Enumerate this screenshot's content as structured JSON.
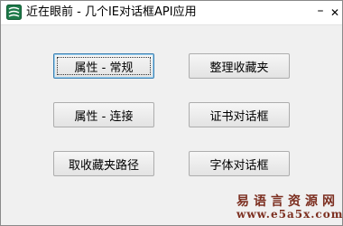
{
  "window": {
    "title": "近在眼前 - 几个IE对话框API应用",
    "app_icon": "app-logo-icon",
    "minimize_label": "–",
    "close_label": "✕"
  },
  "buttons": {
    "props_general": "属性 - 常规",
    "organize_favorites": "整理收藏夹",
    "props_connection": "属性 - 连接",
    "certificate_dialog": "证书对话框",
    "get_favorites_path": "取收藏夹路径",
    "font_dialog": "字体对话框"
  },
  "watermark": {
    "site_name": "易语言资源网",
    "url": "www.e5a5x.com",
    "color": "#7c2f20"
  },
  "colors": {
    "window_bg": "#f0f0f0",
    "title_bg": "#ffffff",
    "focus_border": "#3c7fb1"
  }
}
